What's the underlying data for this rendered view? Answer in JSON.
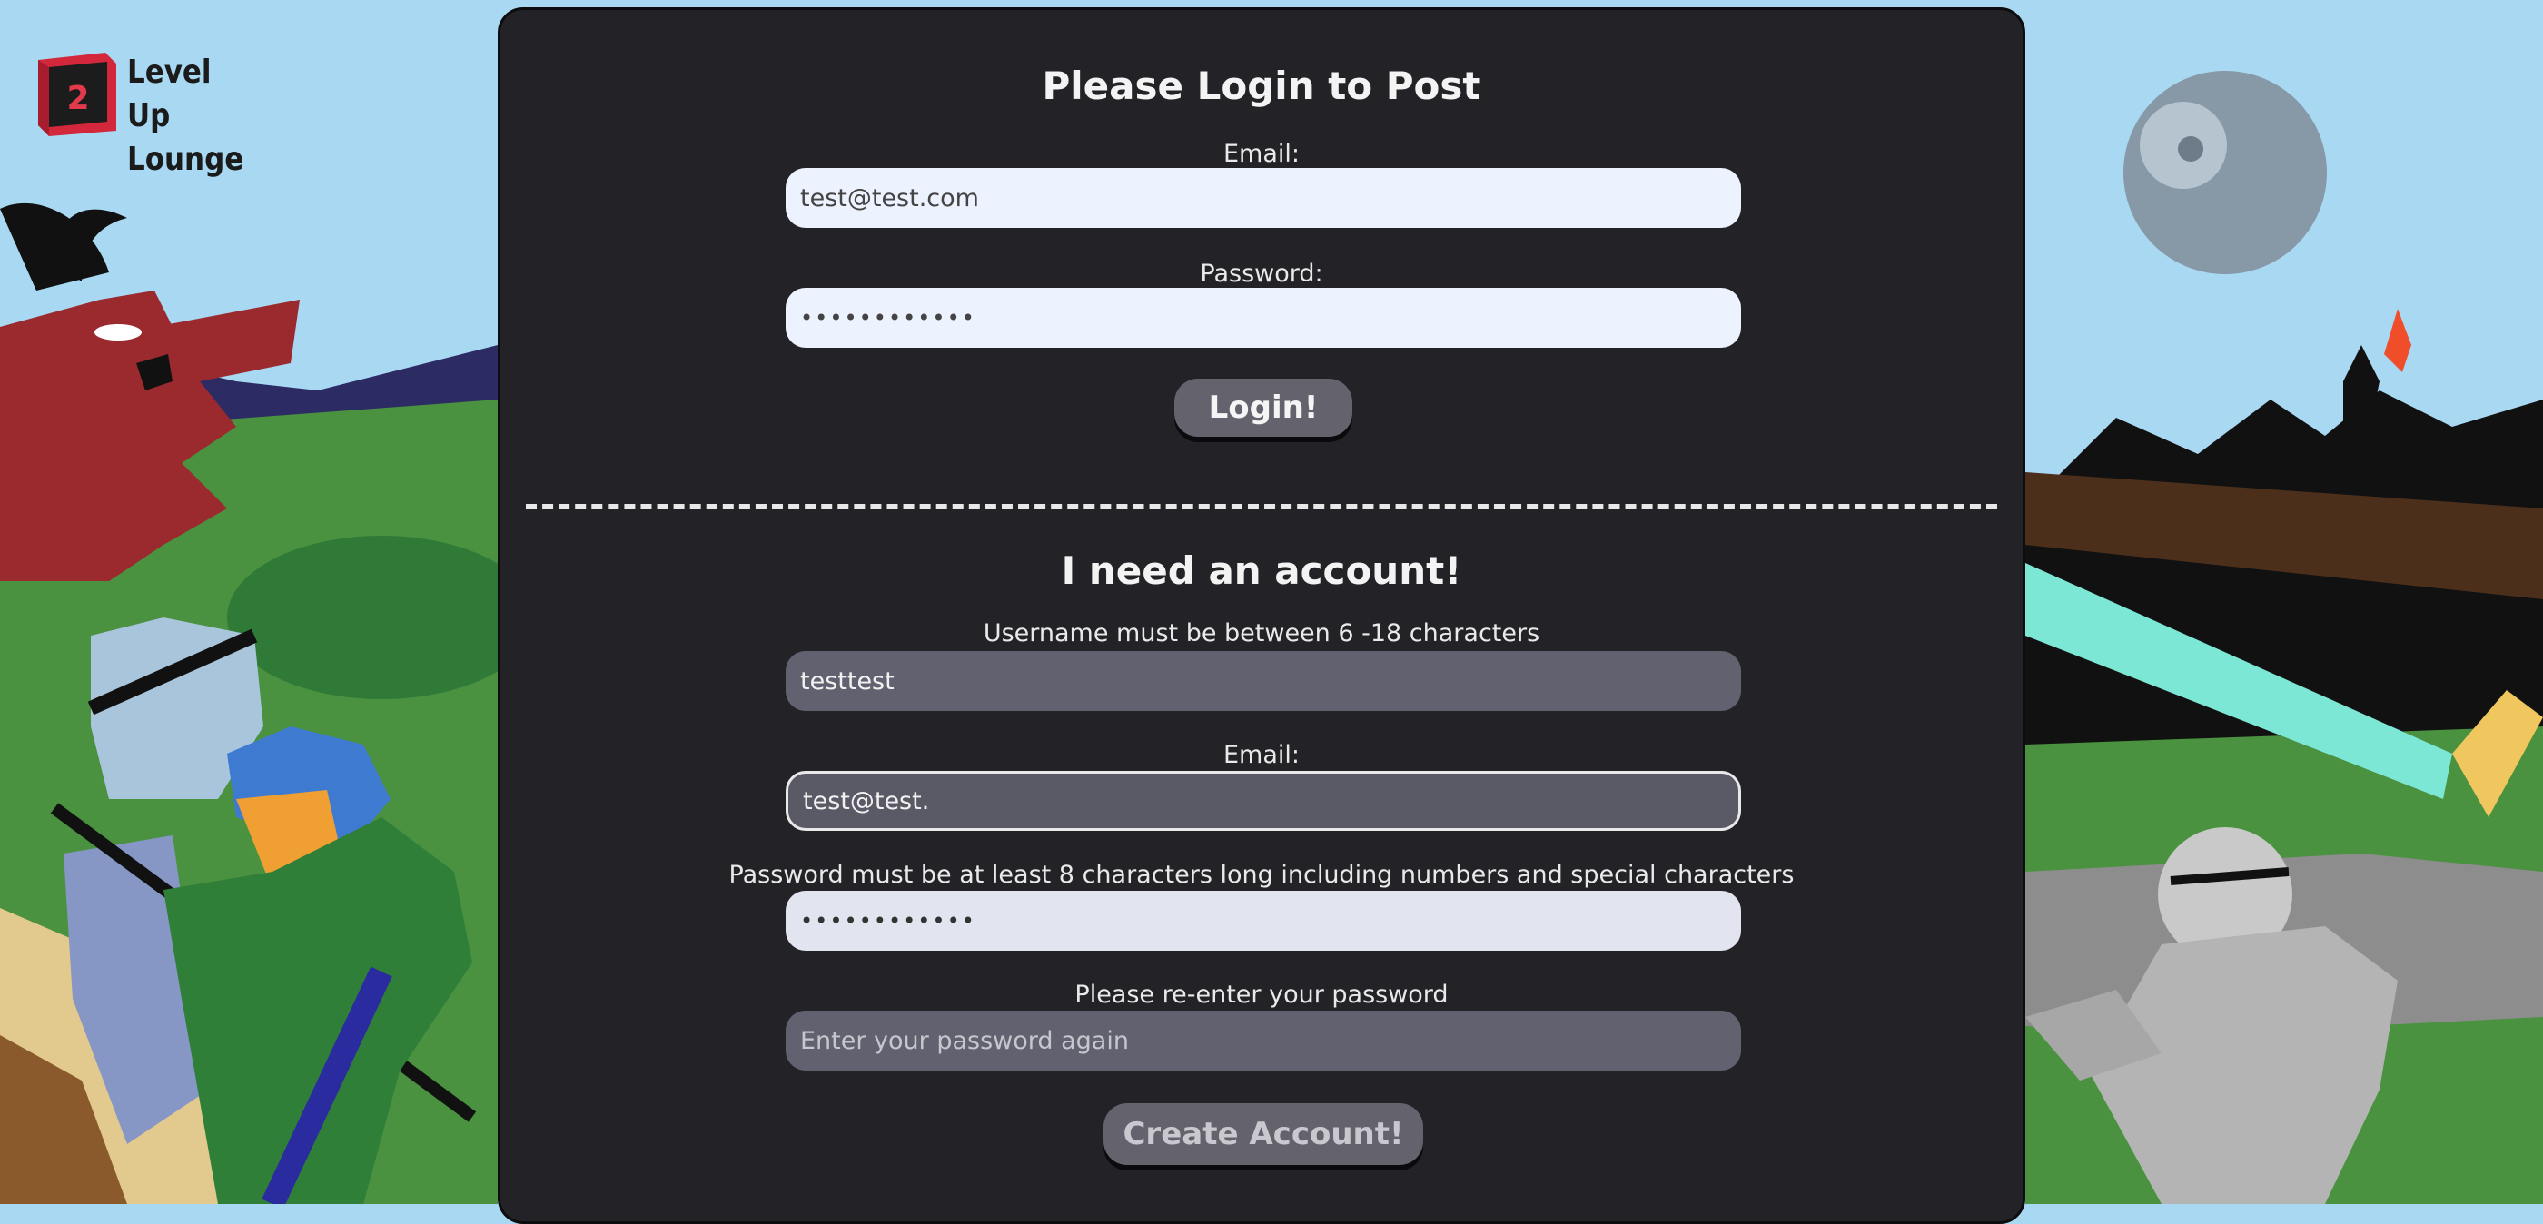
{
  "logo": {
    "number": "2",
    "line1": "Level Up",
    "line2": "Lounge"
  },
  "login": {
    "title": "Please Login to Post",
    "email_label": "Email:",
    "email_value": "test@test.com",
    "password_label": "Password:",
    "password_value": "••••••••••••",
    "button": "Login!"
  },
  "signup": {
    "title": "I need an account!",
    "username_label": "Username must be between 6 -18 characters",
    "username_value": "testtest",
    "email_label": "Email:",
    "email_value": "test@test.",
    "password_label": "Password must be at least 8 characters long including numbers and special characters",
    "password_value": "••••••••••••",
    "repassword_label": "Please re-enter your password",
    "repassword_placeholder": "Enter your password again",
    "button": "Create Account!"
  },
  "colors": {
    "panel": "#232327",
    "light_input": "#edf2ff",
    "dark_input": "#62616f",
    "button": "#64636d"
  }
}
